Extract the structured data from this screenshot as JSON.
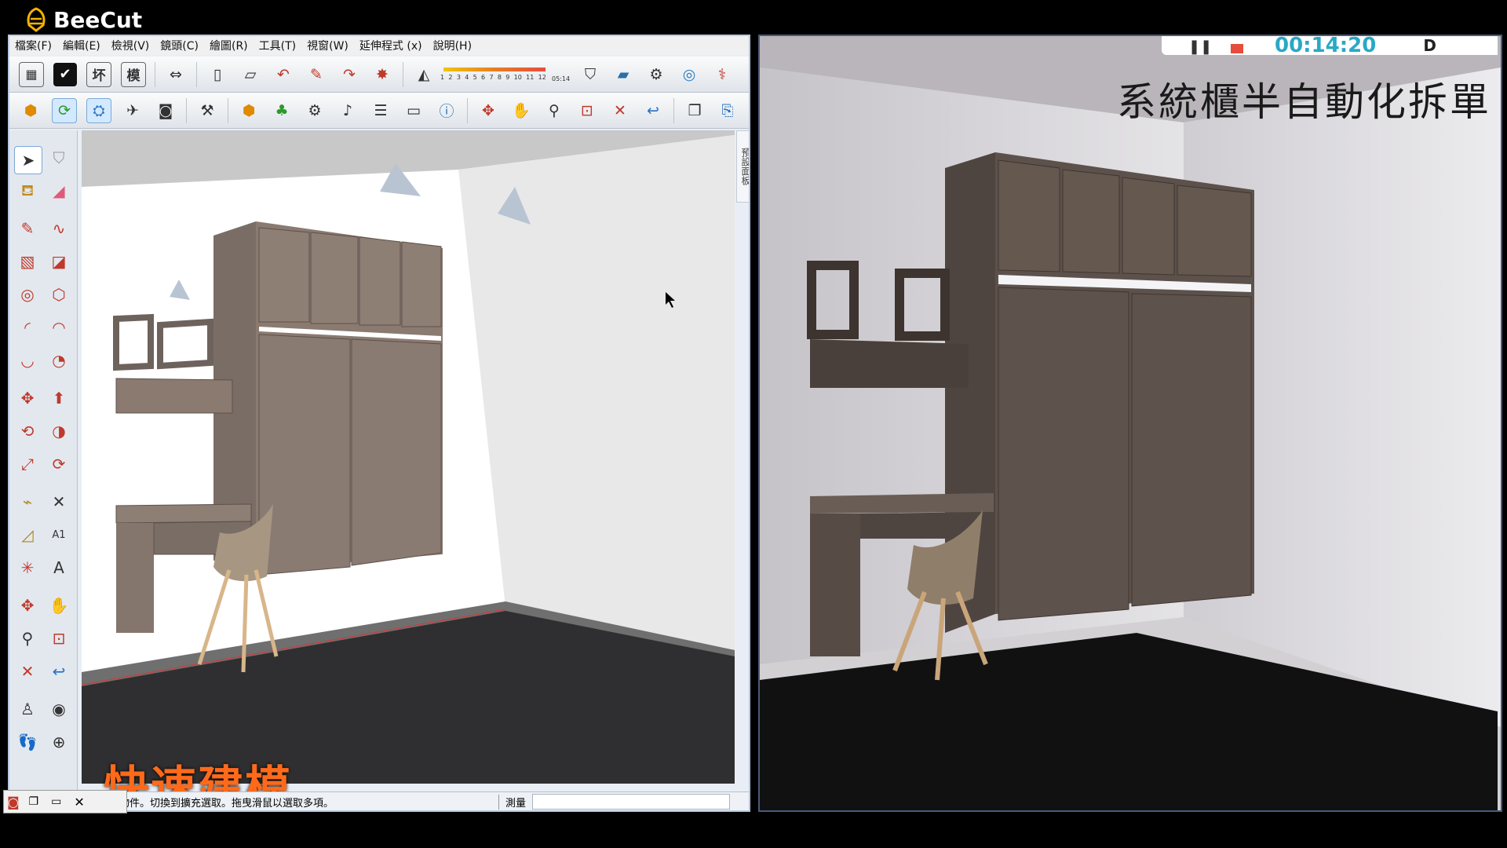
{
  "recorder": {
    "name": "BeeCut"
  },
  "menu": {
    "items": [
      "檔案(F)",
      "編輯(E)",
      "檢視(V)",
      "鏡頭(C)",
      "繪圖(R)",
      "工具(T)",
      "視窗(W)",
      "延伸程式 (x)",
      "說明(H)"
    ]
  },
  "toolbar1": {
    "icons": [
      "grid-icon",
      "check-icon",
      "ring-icon",
      "model-icon",
      "move-arrows-icon",
      "page-icon",
      "page-icon",
      "undo-page-icon",
      "edit-page-icon",
      "redo-page-icon",
      "component-icon",
      "eraser-icon"
    ],
    "labels": {
      "ring": "坏",
      "model": "模"
    },
    "ruler_ticks": [
      "1",
      "2",
      "3",
      "4",
      "5",
      "6",
      "7",
      "8",
      "9",
      "10",
      "11",
      "12"
    ],
    "ruler_end": "05:14"
  },
  "side_panel": {
    "label": "預設面板"
  },
  "caption_left": "快速建模",
  "status": {
    "hint": "物件。切換到擴充選取。拖曳滑鼠以選取多項。",
    "measure_label": "測量"
  },
  "render": {
    "title": "系統櫃半自動化拆單",
    "timer": "00:14:20",
    "timer_side": "D"
  },
  "colors": {
    "cabinet": "#8a7a70",
    "cabinet_dark": "#5d514b",
    "floor": "#2a2a2c",
    "caption": "#ff6a1a",
    "accent": "#2aa8c5"
  }
}
